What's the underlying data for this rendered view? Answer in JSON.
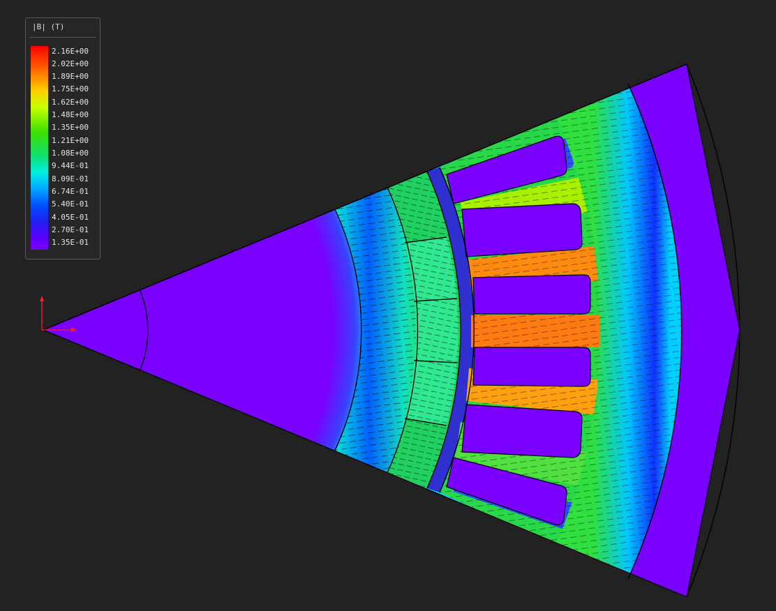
{
  "legend": {
    "title": "|B| (T)",
    "levels": [
      "2.16E+00",
      "2.02E+00",
      "1.89E+00",
      "1.75E+00",
      "1.62E+00",
      "1.48E+00",
      "1.35E+00",
      "1.21E+00",
      "1.08E+00",
      "9.44E-01",
      "8.09E-01",
      "6.74E-01",
      "5.40E-01",
      "4.05E-01",
      "2.70E-01",
      "1.35E-01"
    ]
  },
  "colors": {
    "background": "#222222",
    "low_field": "#7a00ff",
    "mid_field": "#00e0d0",
    "high_field": "#ff7a00",
    "axis": "#ff2020"
  }
}
